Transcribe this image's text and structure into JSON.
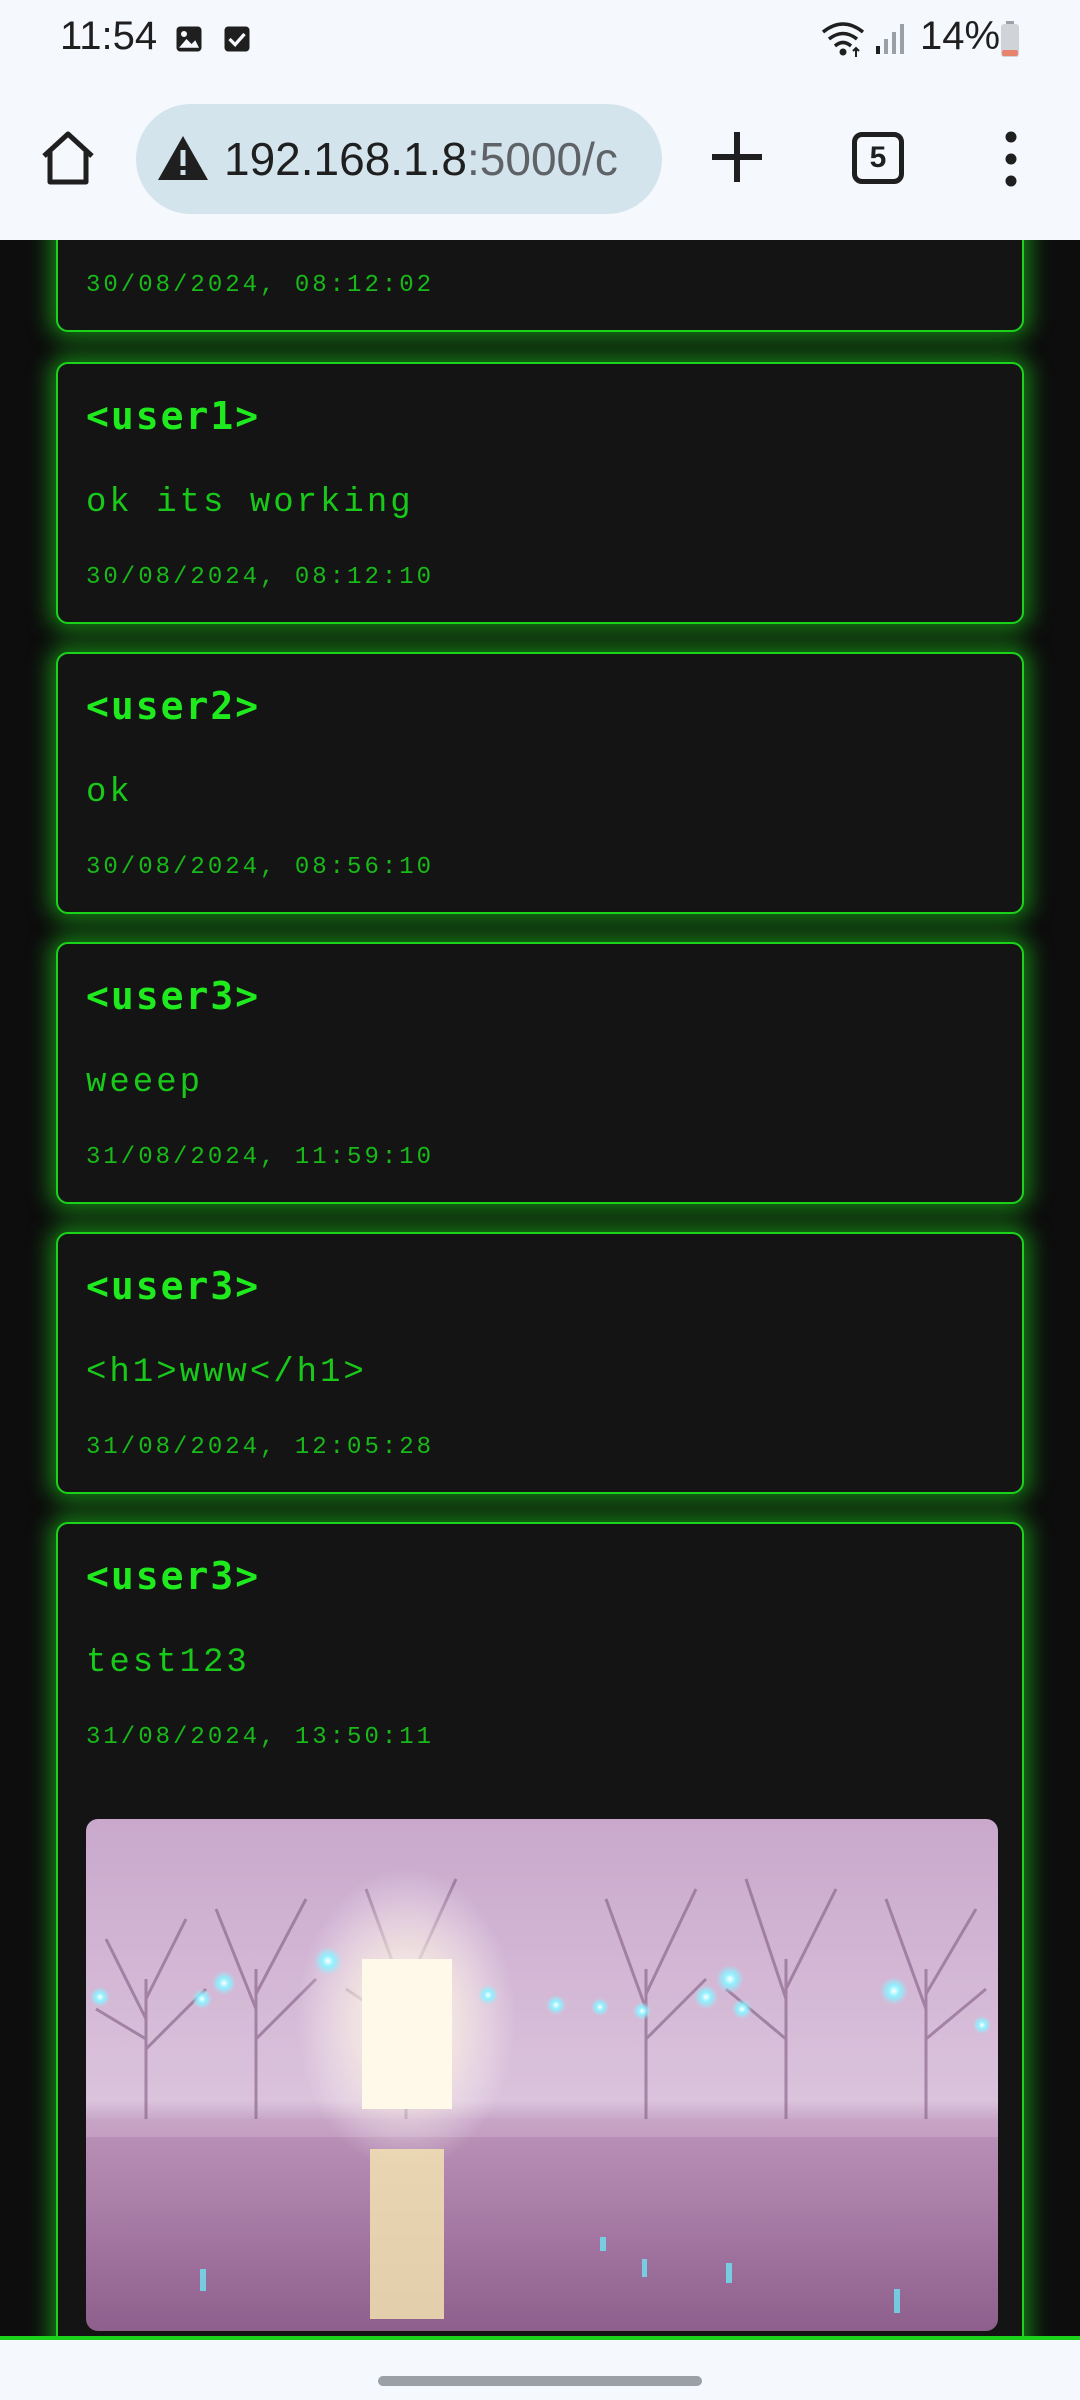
{
  "status_bar": {
    "time": "11:54",
    "battery": "14%",
    "icons": [
      "gallery-icon",
      "check-box-icon",
      "wifi-icon",
      "signal-icon",
      "battery-icon"
    ]
  },
  "browser": {
    "url_host": "192.168.1.8",
    "url_rest": ":5000/c",
    "tab_count": "5",
    "icons": [
      "home-icon",
      "warning-icon",
      "plus-icon",
      "more-vert-icon"
    ]
  },
  "theme": {
    "accent": "#1bd31b",
    "background": "#0d0d0d",
    "card": "#141414"
  },
  "messages": [
    {
      "user": "",
      "text": "",
      "time": "30/08/2024, 08:12:02"
    },
    {
      "user": "<user1>",
      "text": "ok its working",
      "time": "30/08/2024, 08:12:10"
    },
    {
      "user": "<user2>",
      "text": "ok",
      "time": "30/08/2024, 08:56:10"
    },
    {
      "user": "<user3>",
      "text": "weeep",
      "time": "31/08/2024, 11:59:10"
    },
    {
      "user": "<user3>",
      "text": "<h1>www</h1>",
      "time": "31/08/2024, 12:05:28"
    },
    {
      "user": "<user3>",
      "text": "test123",
      "time": "31/08/2024, 13:50:11",
      "has_image": true
    }
  ]
}
